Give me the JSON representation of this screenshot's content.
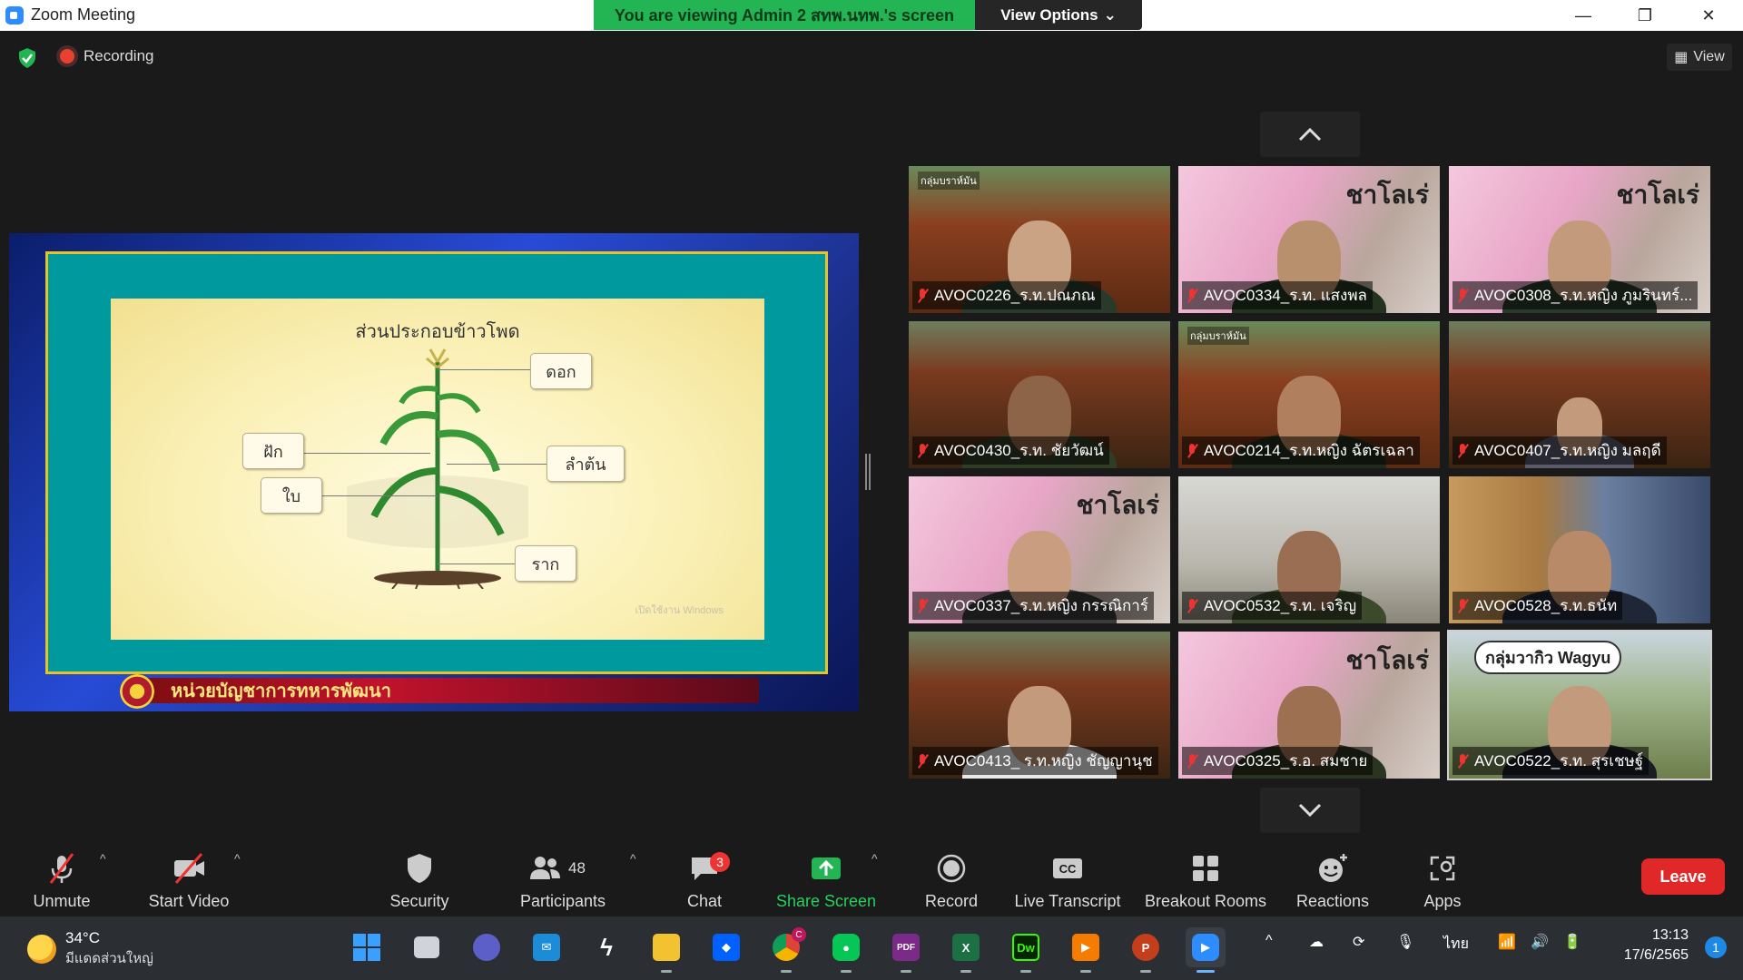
{
  "window": {
    "title": "Zoom Meeting"
  },
  "banner": {
    "viewing_text": "You are viewing Admin 2 สทพ.นทพ.'s screen",
    "view_options": "View Options"
  },
  "status": {
    "recording": "Recording",
    "view": "View"
  },
  "shared_slide": {
    "title": "ส่วนประกอบข้าวโพด",
    "labels": {
      "flower": "ดอก",
      "pod": "ฝัก",
      "stem": "ลำต้น",
      "leaf": "ใบ",
      "root": "ราก"
    },
    "watermark": "เปิดใช้งาน Windows",
    "footer": "หน่วยบัญชาการทหารพัฒนา"
  },
  "participants": [
    {
      "name": "AVOC0226_ร.ท.ปณภณ",
      "tag": "กลุ่มบราห์มัน"
    },
    {
      "name": "AVOC0334_ร.ท. แสงพล",
      "sign": "ชาโลเร่"
    },
    {
      "name": "AVOC0308_ร.ท.หญิง ภูมรินทร์...",
      "sign": "ชาโลเร่"
    },
    {
      "name": "AVOC0430_ร.ท. ชัยวัฒน์"
    },
    {
      "name": "AVOC0214_ร.ท.หญิง ฉัตรเฉลา",
      "tag": "กลุ่มบราห์มัน"
    },
    {
      "name": "AVOC0407_ร.ท.หญิง มลฤดี"
    },
    {
      "name": "AVOC0337_ร.ท.หญิง กรรณิการ์",
      "sign": "ชาโลเร่"
    },
    {
      "name": "AVOC0532_ร.ท. เจริญ"
    },
    {
      "name": "AVOC0528_ร.ท.ธนัท"
    },
    {
      "name": "AVOC0413_ ร.ท.หญิง ชัญญานุช"
    },
    {
      "name": "AVOC0325_ร.อ. สมชาย",
      "sign": "ชาโลเร่"
    },
    {
      "name": "AVOC0522_ร.ท. สุรเชษฐ์",
      "sign": "กลุ่มวากิว Wagyu"
    }
  ],
  "toolbar": {
    "unmute": "Unmute",
    "start_video": "Start Video",
    "security": "Security",
    "participants": "Participants",
    "participants_count": "48",
    "chat": "Chat",
    "chat_badge": "3",
    "share_screen": "Share Screen",
    "record": "Record",
    "live_transcript": "Live Transcript",
    "breakout_rooms": "Breakout Rooms",
    "reactions": "Reactions",
    "apps": "Apps",
    "leave": "Leave"
  },
  "taskbar": {
    "temperature": "34°C",
    "weather": "มีแดดส่วนใหญ่",
    "language": "ไทย",
    "time": "13:13",
    "date": "17/6/2565",
    "notifications": "1",
    "chrome_badge": "C",
    "dw_label": "Dw",
    "pdf_label": "PDF"
  }
}
